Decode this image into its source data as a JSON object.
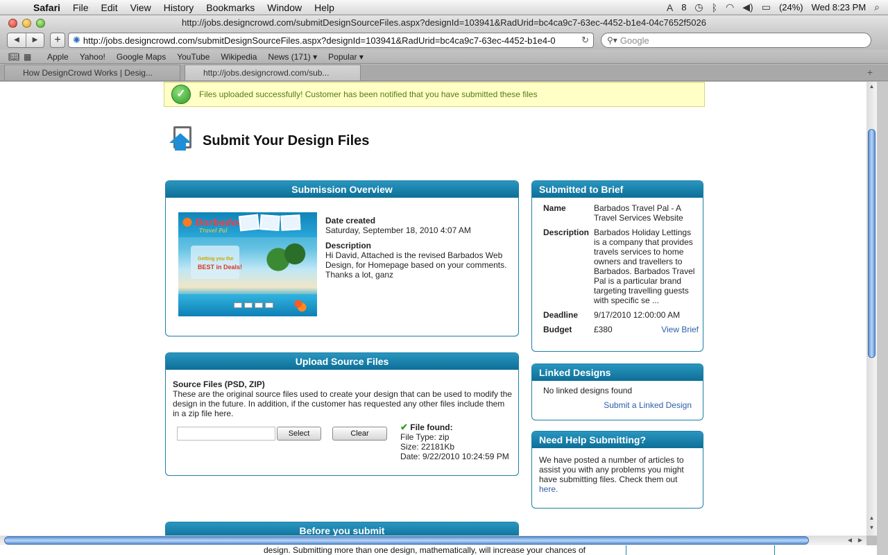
{
  "menubar": {
    "app": "Safari",
    "menus": [
      "File",
      "Edit",
      "View",
      "History",
      "Bookmarks",
      "Window",
      "Help"
    ],
    "status": {
      "adobe_count": "8",
      "battery": "(24%)",
      "clock": "Wed 8:23 PM"
    }
  },
  "window": {
    "title": "http://jobs.designcrowd.com/submitDesignSourceFiles.aspx?designId=103941&RadUrid=bc4ca9c7-63ec-4452-b1e4-04c7652f5026"
  },
  "toolbar": {
    "url": "http://jobs.designcrowd.com/submitDesignSourceFiles.aspx?designId=103941&RadUrid=bc4ca9c7-63ec-4452-b1e4-0",
    "search_placeholder": "Google"
  },
  "bookmarks": [
    "Apple",
    "Yahoo!",
    "Google Maps",
    "YouTube",
    "Wikipedia",
    "News (171) ▾",
    "Popular ▾"
  ],
  "tabs": [
    {
      "label": "How DesignCrowd Works | Desig...",
      "active": false
    },
    {
      "label": "http://jobs.designcrowd.com/sub...",
      "active": true
    }
  ],
  "page": {
    "alert": "Files uploaded successfully! Customer has been notified that you have submitted these files",
    "title": "Submit Your Design Files",
    "overview": {
      "header": "Submission Overview",
      "thumb_logo": "Barbados",
      "thumb_logo_sub": "Travel Pal",
      "thumb_tag1": "Getting you the",
      "thumb_tag2": "BEST in Deals!",
      "date_label": "Date created",
      "date_value": "Saturday, September 18, 2010 4:07 AM",
      "desc_label": "Description",
      "desc_value": "Hi David, Attached is the revised Barbados Web Design, for Homepage based on your comments. Thanks a lot, ganz"
    },
    "brief": {
      "header": "Submitted to Brief",
      "name_label": "Name",
      "name_value": "Barbados Travel Pal - A Travel Services Website",
      "desc_label": "Description",
      "desc_value": "Barbados Holiday Lettings is a company that provides travels services to home owners and travellers to Barbados. Barbados Travel Pal is a particular brand targeting travelling guests with specific se ...",
      "deadline_label": "Deadline",
      "deadline_value": "9/17/2010 12:00:00 AM",
      "budget_label": "Budget",
      "budget_value": "£380",
      "view_brief": "View Brief"
    },
    "linked": {
      "header": "Linked Designs",
      "none": "No linked designs found",
      "submit_link": "Submit a Linked Design"
    },
    "help": {
      "header": "Need Help Submitting?",
      "text": "We have posted a number of articles to assist you with any problems you might have submitting files. Check them out",
      "link": "here."
    },
    "upload": {
      "header": "Upload Source Files",
      "title": "Source Files (PSD, ZIP)",
      "desc": "These are the original source files used to create your design that can be used to modify the design in the future. In addition, if the customer has requested any other files include them in a zip file here.",
      "select_label": "Select",
      "clear_label": "Clear",
      "found_label": "File found:",
      "file_type": "File Type: zip",
      "file_size": "Size: 22181Kb",
      "file_date": "Date: 9/22/2010 10:24:59 PM"
    },
    "before": {
      "header": "Before you submit"
    },
    "bottom_text": "design. Submitting more than one design, mathematically, will increase your chances of"
  }
}
